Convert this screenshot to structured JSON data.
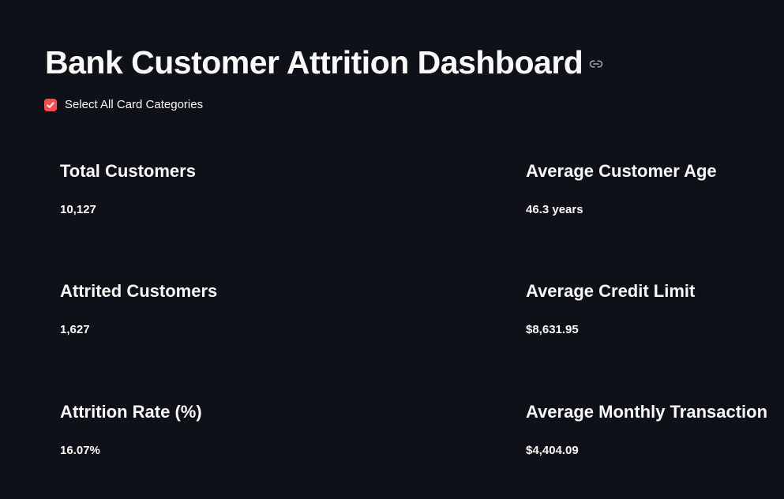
{
  "header": {
    "title": "Bank Customer Attrition Dashboard",
    "anchor_icon": "link-icon"
  },
  "filter": {
    "label": "Select All Card Categories",
    "checked": true,
    "accent_color": "#ff4b4b"
  },
  "metrics": {
    "total_customers": {
      "title": "Total Customers",
      "value": "10,127"
    },
    "attrited_customers": {
      "title": "Attrited Customers",
      "value": "1,627"
    },
    "attrition_rate": {
      "title": "Attrition Rate (%)",
      "value": "16.07%"
    },
    "average_age": {
      "title": "Average Customer Age",
      "value": "46.3 years"
    },
    "average_credit_limit": {
      "title": "Average Credit Limit",
      "value": "$8,631.95"
    },
    "average_monthly_transaction": {
      "title": "Average Monthly Transaction",
      "value": "$4,404.09"
    }
  },
  "theme": {
    "background": "#0e1117",
    "text": "#fafafa"
  }
}
